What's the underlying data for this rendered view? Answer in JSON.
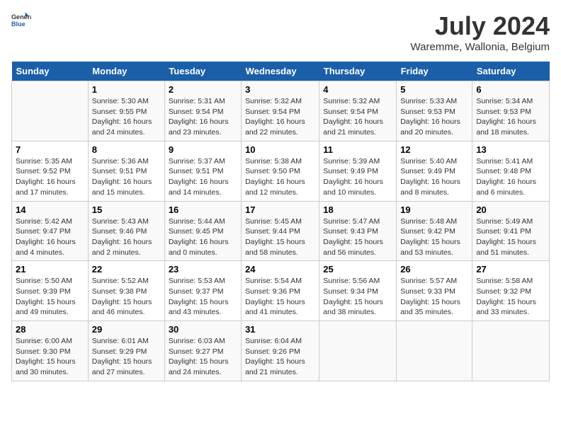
{
  "logo": {
    "general": "General",
    "blue": "Blue"
  },
  "title": "July 2024",
  "subtitle": "Waremme, Wallonia, Belgium",
  "days": [
    "Sunday",
    "Monday",
    "Tuesday",
    "Wednesday",
    "Thursday",
    "Friday",
    "Saturday"
  ],
  "weeks": [
    [
      {
        "date": "",
        "sunrise": "",
        "sunset": "",
        "daylight": ""
      },
      {
        "date": "1",
        "sunrise": "Sunrise: 5:30 AM",
        "sunset": "Sunset: 9:55 PM",
        "daylight": "Daylight: 16 hours and 24 minutes."
      },
      {
        "date": "2",
        "sunrise": "Sunrise: 5:31 AM",
        "sunset": "Sunset: 9:54 PM",
        "daylight": "Daylight: 16 hours and 23 minutes."
      },
      {
        "date": "3",
        "sunrise": "Sunrise: 5:32 AM",
        "sunset": "Sunset: 9:54 PM",
        "daylight": "Daylight: 16 hours and 22 minutes."
      },
      {
        "date": "4",
        "sunrise": "Sunrise: 5:32 AM",
        "sunset": "Sunset: 9:54 PM",
        "daylight": "Daylight: 16 hours and 21 minutes."
      },
      {
        "date": "5",
        "sunrise": "Sunrise: 5:33 AM",
        "sunset": "Sunset: 9:53 PM",
        "daylight": "Daylight: 16 hours and 20 minutes."
      },
      {
        "date": "6",
        "sunrise": "Sunrise: 5:34 AM",
        "sunset": "Sunset: 9:53 PM",
        "daylight": "Daylight: 16 hours and 18 minutes."
      }
    ],
    [
      {
        "date": "7",
        "sunrise": "Sunrise: 5:35 AM",
        "sunset": "Sunset: 9:52 PM",
        "daylight": "Daylight: 16 hours and 17 minutes."
      },
      {
        "date": "8",
        "sunrise": "Sunrise: 5:36 AM",
        "sunset": "Sunset: 9:51 PM",
        "daylight": "Daylight: 16 hours and 15 minutes."
      },
      {
        "date": "9",
        "sunrise": "Sunrise: 5:37 AM",
        "sunset": "Sunset: 9:51 PM",
        "daylight": "Daylight: 16 hours and 14 minutes."
      },
      {
        "date": "10",
        "sunrise": "Sunrise: 5:38 AM",
        "sunset": "Sunset: 9:50 PM",
        "daylight": "Daylight: 16 hours and 12 minutes."
      },
      {
        "date": "11",
        "sunrise": "Sunrise: 5:39 AM",
        "sunset": "Sunset: 9:49 PM",
        "daylight": "Daylight: 16 hours and 10 minutes."
      },
      {
        "date": "12",
        "sunrise": "Sunrise: 5:40 AM",
        "sunset": "Sunset: 9:49 PM",
        "daylight": "Daylight: 16 hours and 8 minutes."
      },
      {
        "date": "13",
        "sunrise": "Sunrise: 5:41 AM",
        "sunset": "Sunset: 9:48 PM",
        "daylight": "Daylight: 16 hours and 6 minutes."
      }
    ],
    [
      {
        "date": "14",
        "sunrise": "Sunrise: 5:42 AM",
        "sunset": "Sunset: 9:47 PM",
        "daylight": "Daylight: 16 hours and 4 minutes."
      },
      {
        "date": "15",
        "sunrise": "Sunrise: 5:43 AM",
        "sunset": "Sunset: 9:46 PM",
        "daylight": "Daylight: 16 hours and 2 minutes."
      },
      {
        "date": "16",
        "sunrise": "Sunrise: 5:44 AM",
        "sunset": "Sunset: 9:45 PM",
        "daylight": "Daylight: 16 hours and 0 minutes."
      },
      {
        "date": "17",
        "sunrise": "Sunrise: 5:45 AM",
        "sunset": "Sunset: 9:44 PM",
        "daylight": "Daylight: 15 hours and 58 minutes."
      },
      {
        "date": "18",
        "sunrise": "Sunrise: 5:47 AM",
        "sunset": "Sunset: 9:43 PM",
        "daylight": "Daylight: 15 hours and 56 minutes."
      },
      {
        "date": "19",
        "sunrise": "Sunrise: 5:48 AM",
        "sunset": "Sunset: 9:42 PM",
        "daylight": "Daylight: 15 hours and 53 minutes."
      },
      {
        "date": "20",
        "sunrise": "Sunrise: 5:49 AM",
        "sunset": "Sunset: 9:41 PM",
        "daylight": "Daylight: 15 hours and 51 minutes."
      }
    ],
    [
      {
        "date": "21",
        "sunrise": "Sunrise: 5:50 AM",
        "sunset": "Sunset: 9:39 PM",
        "daylight": "Daylight: 15 hours and 49 minutes."
      },
      {
        "date": "22",
        "sunrise": "Sunrise: 5:52 AM",
        "sunset": "Sunset: 9:38 PM",
        "daylight": "Daylight: 15 hours and 46 minutes."
      },
      {
        "date": "23",
        "sunrise": "Sunrise: 5:53 AM",
        "sunset": "Sunset: 9:37 PM",
        "daylight": "Daylight: 15 hours and 43 minutes."
      },
      {
        "date": "24",
        "sunrise": "Sunrise: 5:54 AM",
        "sunset": "Sunset: 9:36 PM",
        "daylight": "Daylight: 15 hours and 41 minutes."
      },
      {
        "date": "25",
        "sunrise": "Sunrise: 5:56 AM",
        "sunset": "Sunset: 9:34 PM",
        "daylight": "Daylight: 15 hours and 38 minutes."
      },
      {
        "date": "26",
        "sunrise": "Sunrise: 5:57 AM",
        "sunset": "Sunset: 9:33 PM",
        "daylight": "Daylight: 15 hours and 35 minutes."
      },
      {
        "date": "27",
        "sunrise": "Sunrise: 5:58 AM",
        "sunset": "Sunset: 9:32 PM",
        "daylight": "Daylight: 15 hours and 33 minutes."
      }
    ],
    [
      {
        "date": "28",
        "sunrise": "Sunrise: 6:00 AM",
        "sunset": "Sunset: 9:30 PM",
        "daylight": "Daylight: 15 hours and 30 minutes."
      },
      {
        "date": "29",
        "sunrise": "Sunrise: 6:01 AM",
        "sunset": "Sunset: 9:29 PM",
        "daylight": "Daylight: 15 hours and 27 minutes."
      },
      {
        "date": "30",
        "sunrise": "Sunrise: 6:03 AM",
        "sunset": "Sunset: 9:27 PM",
        "daylight": "Daylight: 15 hours and 24 minutes."
      },
      {
        "date": "31",
        "sunrise": "Sunrise: 6:04 AM",
        "sunset": "Sunset: 9:26 PM",
        "daylight": "Daylight: 15 hours and 21 minutes."
      },
      {
        "date": "",
        "sunrise": "",
        "sunset": "",
        "daylight": ""
      },
      {
        "date": "",
        "sunrise": "",
        "sunset": "",
        "daylight": ""
      },
      {
        "date": "",
        "sunrise": "",
        "sunset": "",
        "daylight": ""
      }
    ]
  ]
}
